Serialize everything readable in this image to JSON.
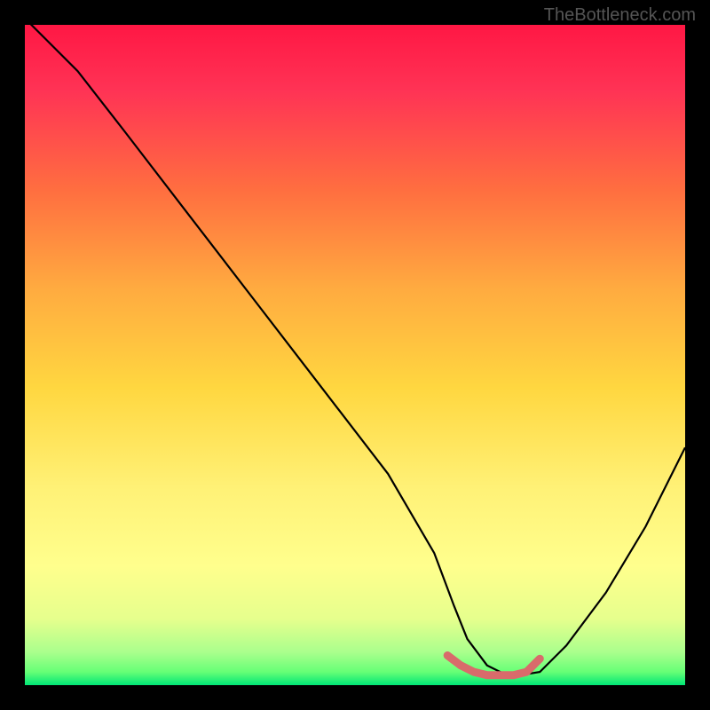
{
  "watermark": "TheBottleneck.com",
  "colors": {
    "gradient_stops": [
      "#ff1744",
      "#ff3d4a",
      "#ff6e40",
      "#ffab40",
      "#ffd740",
      "#fff176",
      "#ffff8d",
      "#d4ff8d",
      "#76ff76",
      "#00e676"
    ],
    "curve": "#000000",
    "marker": "#d96b6b",
    "frame_bg": "#000000"
  },
  "chart_data": {
    "type": "line",
    "title": "",
    "xlabel": "",
    "ylabel": "",
    "xlim": [
      0,
      100
    ],
    "ylim": [
      0,
      100
    ],
    "series": [
      {
        "name": "bottleneck-curve",
        "x": [
          0,
          3,
          8,
          15,
          25,
          35,
          45,
          55,
          62,
          65,
          67,
          70,
          73,
          75,
          78,
          82,
          88,
          94,
          100
        ],
        "y": [
          101,
          98,
          93,
          84,
          71,
          58,
          45,
          32,
          20,
          12,
          7,
          3,
          1.5,
          1.5,
          2,
          6,
          14,
          24,
          36
        ]
      }
    ],
    "marker": {
      "name": "optimal-range",
      "x": [
        64,
        66,
        68,
        70,
        72,
        74,
        76,
        78
      ],
      "y": [
        4.5,
        3,
        2,
        1.5,
        1.5,
        1.5,
        2,
        4
      ]
    },
    "bands": [
      {
        "y0": 0,
        "y1": 2.5,
        "color": "#00e676"
      },
      {
        "y0": 2.5,
        "y1": 6,
        "color": "#b2ff59"
      },
      {
        "y0": 6,
        "y1": 12,
        "color": "#ffff8d"
      },
      {
        "y0": 12,
        "y1": 100,
        "color": "gradient"
      }
    ]
  }
}
